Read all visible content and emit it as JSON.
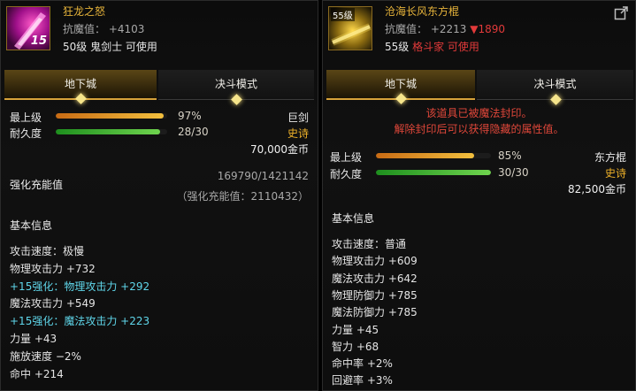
{
  "left": {
    "icon_badge": "15",
    "name": "狂龙之怒",
    "resist": "抗魔值： +4103",
    "requirement": "50级 鬼剑士 可使用",
    "tabs": [
      "地下城",
      "决斗模式"
    ],
    "grade_label": "最上级",
    "grade_pct": "97%",
    "grade_level": 0.97,
    "durability_label": "耐久度",
    "durability": "28/30",
    "durability_level": 0.933,
    "type": "巨剑",
    "rarity": "史诗",
    "price": "70,000金币",
    "charge_label": "强化充能值",
    "charge_value": "169790/1421142",
    "charge_sub": "（强化充能值：2110432）",
    "basic_info": "基本信息",
    "stats": [
      {
        "text": "攻击速度：极慢",
        "cls": ""
      },
      {
        "text": "物理攻击力 +732",
        "cls": ""
      },
      {
        "text": "+15强化：物理攻击力 +292",
        "cls": "cyan"
      },
      {
        "text": "魔法攻击力 +549",
        "cls": ""
      },
      {
        "text": "+15强化：魔法攻击力 +223",
        "cls": "cyan"
      },
      {
        "text": "力量 +43",
        "cls": ""
      },
      {
        "text": "施放速度 −2%",
        "cls": ""
      },
      {
        "text": "命中 +214",
        "cls": ""
      }
    ]
  },
  "right": {
    "icon_badge": "55级",
    "name": "沧海长风东方棍",
    "resist_prefix": "抗魔值： +2213",
    "resist_diff": "▼1890",
    "req_level": "55级",
    "req_class": "格斗家 可使用",
    "tabs": [
      "地下城",
      "决斗模式"
    ],
    "seal_line1": "该道具已被魔法封印。",
    "seal_line2": "解除封印后可以获得隐藏的属性值。",
    "grade_label": "最上级",
    "grade_pct": "85%",
    "grade_level": 0.85,
    "durability_label": "耐久度",
    "durability": "30/30",
    "durability_level": 1.0,
    "type": "东方棍",
    "rarity": "史诗",
    "price": "82,500金币",
    "basic_info": "基本信息",
    "stats": [
      {
        "text": "攻击速度：普通",
        "cls": ""
      },
      {
        "text": "物理攻击力 +609",
        "cls": ""
      },
      {
        "text": "魔法攻击力 +642",
        "cls": ""
      },
      {
        "text": "物理防御力 +785",
        "cls": ""
      },
      {
        "text": "魔法防御力 +785",
        "cls": ""
      },
      {
        "text": "力量 +45",
        "cls": ""
      },
      {
        "text": "智力 +68",
        "cls": ""
      },
      {
        "text": "命中率 +2%",
        "cls": ""
      },
      {
        "text": "回避率 +3%",
        "cls": ""
      }
    ]
  },
  "colors": {
    "gold": "#f0b229",
    "name": "#e6b33a",
    "cyan": "#5fd6ea",
    "red": "#e23a3a",
    "tab_active": "#5a4616"
  },
  "icons": {
    "left": "greatsword-item-icon",
    "right": "staff-item-icon",
    "share": "share-icon"
  }
}
